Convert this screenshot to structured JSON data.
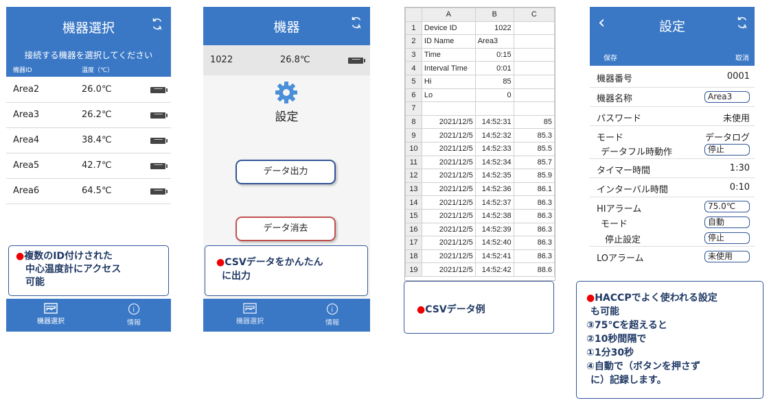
{
  "colors": {
    "header_blue": "#3a78c6",
    "callout_border": "#2f5597",
    "callout_text": "#1f3864",
    "bullet_red": "#e00000",
    "delete_border": "#c0504d",
    "output_border": "#2f5597"
  },
  "screen1": {
    "title": "機器選択",
    "subtitle": "接続する機器を選択してください",
    "col_id": "機器ID",
    "col_temp": "温度（℃）",
    "devices": [
      {
        "name": "Area2",
        "temp": "26.0℃"
      },
      {
        "name": "Area3",
        "temp": "26.2℃"
      },
      {
        "name": "Area4",
        "temp": "38.4℃"
      },
      {
        "name": "Area5",
        "temp": "42.7℃"
      },
      {
        "name": "Area6",
        "temp": "64.5℃"
      }
    ],
    "nav": {
      "select": "機器選択",
      "info": "情報"
    },
    "icons": [
      "refresh-icon",
      "battery-icon",
      "device-list-icon",
      "info-icon"
    ]
  },
  "callout1": {
    "bullet": "●",
    "lines": [
      "複数のID付けされた",
      "中心温度計にアクセス",
      "可能"
    ]
  },
  "screen2": {
    "title": "機器",
    "device_id": "1022",
    "device_temp": "26.8℃",
    "settings_label": "設定",
    "output_button": "データ出力",
    "delete_button": "データ消去",
    "nav": {
      "select": "機器選択",
      "info": "情報"
    },
    "icons": [
      "refresh-icon",
      "battery-icon",
      "gear-icon"
    ]
  },
  "callout2": {
    "bullet": "●",
    "lines": [
      "CSVデータをかんたん",
      "に出力"
    ]
  },
  "sheet": {
    "col_headers": [
      "A",
      "B",
      "C"
    ],
    "rows": [
      {
        "n": "1",
        "a": "Device ID",
        "b": "1022",
        "c": ""
      },
      {
        "n": "2",
        "a": "ID Name",
        "b": "Area3",
        "c": ""
      },
      {
        "n": "3",
        "a": "Time",
        "b": "0:15",
        "c": ""
      },
      {
        "n": "4",
        "a": "Interval Time",
        "b": "0:01",
        "c": ""
      },
      {
        "n": "5",
        "a": "Hi",
        "b": "85",
        "c": ""
      },
      {
        "n": "6",
        "a": "Lo",
        "b": "0",
        "c": ""
      },
      {
        "n": "7",
        "a": "",
        "b": "",
        "c": ""
      },
      {
        "n": "8",
        "a": "2021/12/5",
        "b": "14:52:31",
        "c": "85"
      },
      {
        "n": "9",
        "a": "2021/12/5",
        "b": "14:52:32",
        "c": "85.3"
      },
      {
        "n": "10",
        "a": "2021/12/5",
        "b": "14:52:33",
        "c": "85.5"
      },
      {
        "n": "11",
        "a": "2021/12/5",
        "b": "14:52:34",
        "c": "85.7"
      },
      {
        "n": "12",
        "a": "2021/12/5",
        "b": "14:52:35",
        "c": "85.9"
      },
      {
        "n": "13",
        "a": "2021/12/5",
        "b": "14:52:36",
        "c": "86.1"
      },
      {
        "n": "14",
        "a": "2021/12/5",
        "b": "14:52:37",
        "c": "86.3"
      },
      {
        "n": "15",
        "a": "2021/12/5",
        "b": "14:52:38",
        "c": "86.3"
      },
      {
        "n": "16",
        "a": "2021/12/5",
        "b": "14:52:39",
        "c": "86.3"
      },
      {
        "n": "17",
        "a": "2021/12/5",
        "b": "14:52:40",
        "c": "86.3"
      },
      {
        "n": "18",
        "a": "2021/12/5",
        "b": "14:52:41",
        "c": "86.3"
      },
      {
        "n": "19",
        "a": "2021/12/5",
        "b": "14:52:42",
        "c": "88.6"
      }
    ]
  },
  "callout3": {
    "bullet": "●",
    "text": "CSVデータ例"
  },
  "screen4": {
    "title": "設定",
    "save": "保存",
    "cancel": "取消",
    "device_number_label": "機器番号",
    "device_number": "0001",
    "device_name_label": "機器名称",
    "device_name": "Area3",
    "password_label": "パスワード",
    "password": "未使用",
    "mode_label": "モード",
    "mode": "データログ",
    "datafull_label": "データフル時動作",
    "datafull": "停止",
    "timer_label": "タイマー時間",
    "timer": "1:30",
    "interval_label": "インターバル時間",
    "interval": "0:10",
    "hi_alarm_label": "HIアラーム",
    "hi_alarm": "75.0℃",
    "hi_mode_label": "モード",
    "hi_mode": "自動",
    "stop_setting_label": "停止設定",
    "stop_setting": "停止",
    "lo_alarm_label": "LOアラーム",
    "lo_alarm": "未使用",
    "icons": [
      "back-chevron-icon",
      "refresh-icon"
    ]
  },
  "callout4": {
    "bullet": "●",
    "lines": [
      "HACCPでよく使われる設定",
      "も可能",
      "③75℃を超えると",
      "②10秒間隔で",
      "①1分30秒",
      "④自動で（ボタンを押さず",
      "に）記録します。"
    ]
  }
}
